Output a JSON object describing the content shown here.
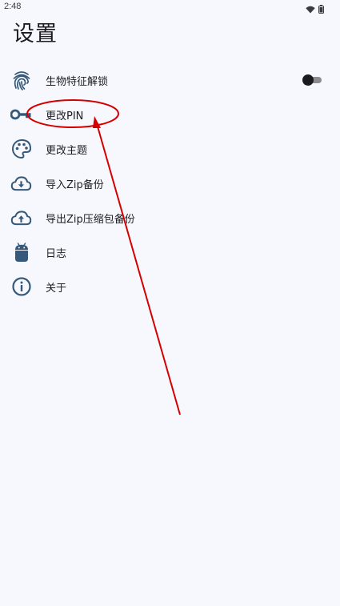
{
  "status_bar": {
    "time": "2:48",
    "icons": [
      "wifi-icon",
      "battery-icon"
    ]
  },
  "page": {
    "title": "设置"
  },
  "menu": {
    "items": [
      {
        "label": "生物特征解锁",
        "icon": "fingerprint-icon",
        "toggle": false
      },
      {
        "label": "更改PIN",
        "icon": "key-icon"
      },
      {
        "label": "更改主题",
        "icon": "palette-icon"
      },
      {
        "label": "导入Zip备份",
        "icon": "cloud-download-icon"
      },
      {
        "label": "导出Zip压缩包备份",
        "icon": "cloud-upload-icon"
      },
      {
        "label": "日志",
        "icon": "android-icon"
      },
      {
        "label": "关于",
        "icon": "info-icon"
      }
    ]
  },
  "colors": {
    "icon": "#36597a",
    "annotation": "#d40000",
    "background": "#f7f8fd"
  }
}
